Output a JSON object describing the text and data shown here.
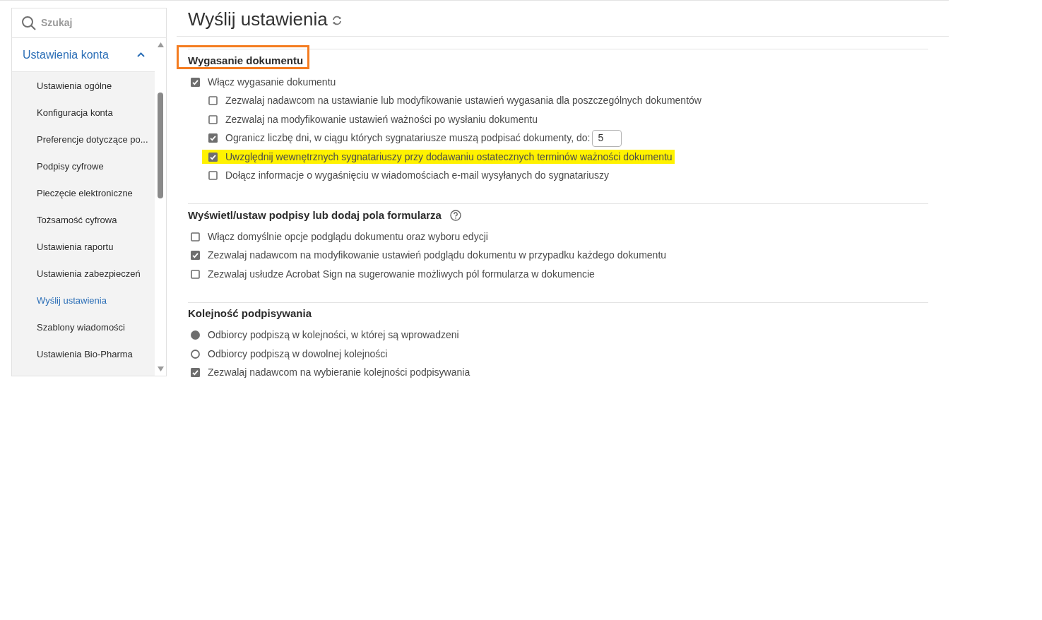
{
  "sidebar": {
    "search": {
      "placeholder": "Szukaj"
    },
    "group": {
      "label": "Ustawienia konta",
      "expanded": true
    },
    "items": [
      {
        "label": "Ustawienia ogólne",
        "selected": false
      },
      {
        "label": "Konfiguracja konta",
        "selected": false
      },
      {
        "label": "Preferencje dotyczące po...",
        "selected": false
      },
      {
        "label": "Podpisy cyfrowe",
        "selected": false
      },
      {
        "label": "Pieczęcie elektroniczne",
        "selected": false
      },
      {
        "label": "Tożsamość cyfrowa",
        "selected": false
      },
      {
        "label": "Ustawienia raportu",
        "selected": false
      },
      {
        "label": "Ustawienia zabezpieczeń",
        "selected": false
      },
      {
        "label": "Wyślij ustawienia",
        "selected": true
      },
      {
        "label": "Szablony wiadomości",
        "selected": false
      },
      {
        "label": "Ustawienia Bio-Pharma",
        "selected": false
      }
    ]
  },
  "page": {
    "title": "Wyślij ustawienia"
  },
  "sections": [
    {
      "heading": "Wygasanie dokumentu",
      "outlined": true,
      "help": false,
      "items": [
        {
          "kind": "checkbox",
          "label": "Włącz wygasanie dokumentu",
          "checked": true,
          "highlighted": false,
          "children": [
            {
              "kind": "checkbox",
              "label": "Zezwalaj nadawcom na ustawianie lub modyfikowanie ustawień wygasania dla poszczególnych dokumentów",
              "checked": false,
              "highlighted": false
            },
            {
              "kind": "checkbox",
              "label": "Zezwalaj na modyfikowanie ustawień ważności po wysłaniu dokumentu",
              "checked": false,
              "highlighted": false
            },
            {
              "kind": "checkbox",
              "label": "Ogranicz liczbę dni, w ciągu których sygnatariusze muszą podpisać dokumenty, do:",
              "checked": true,
              "highlighted": false,
              "input_value": "5"
            },
            {
              "kind": "checkbox",
              "label": "Uwzględnij wewnętrznych sygnatariuszy przy dodawaniu ostatecznych terminów ważności dokumentu",
              "checked": true,
              "highlighted": true
            },
            {
              "kind": "checkbox",
              "label": "Dołącz informacje o wygaśnięciu w wiadomościach e-mail wysyłanych do sygnatariuszy",
              "checked": false,
              "highlighted": false
            }
          ]
        }
      ]
    },
    {
      "heading": "Wyświetl/ustaw podpisy lub dodaj pola formularza",
      "outlined": false,
      "help": true,
      "items": [
        {
          "kind": "checkbox",
          "label": "Włącz domyślnie opcje podglądu dokumentu oraz wyboru edycji",
          "checked": false,
          "highlighted": false
        },
        {
          "kind": "checkbox",
          "label": "Zezwalaj nadawcom na modyfikowanie ustawień podglądu dokumentu w przypadku każdego dokumentu",
          "checked": true,
          "highlighted": false
        },
        {
          "kind": "checkbox",
          "label": "Zezwalaj usłudze Acrobat Sign na sugerowanie możliwych pól formularza w dokumencie",
          "checked": false,
          "highlighted": false
        }
      ]
    },
    {
      "heading": "Kolejność podpisywania",
      "outlined": false,
      "help": false,
      "items": [
        {
          "kind": "radio",
          "label": "Odbiorcy podpiszą w kolejności, w której są wprowadzeni",
          "selected": true,
          "highlighted": false
        },
        {
          "kind": "radio",
          "label": "Odbiorcy podpiszą w dowolnej kolejności",
          "selected": false,
          "highlighted": false
        },
        {
          "kind": "checkbox",
          "label": "Zezwalaj nadawcom na wybieranie kolejności podpisywania",
          "checked": true,
          "highlighted": false
        }
      ]
    }
  ]
}
